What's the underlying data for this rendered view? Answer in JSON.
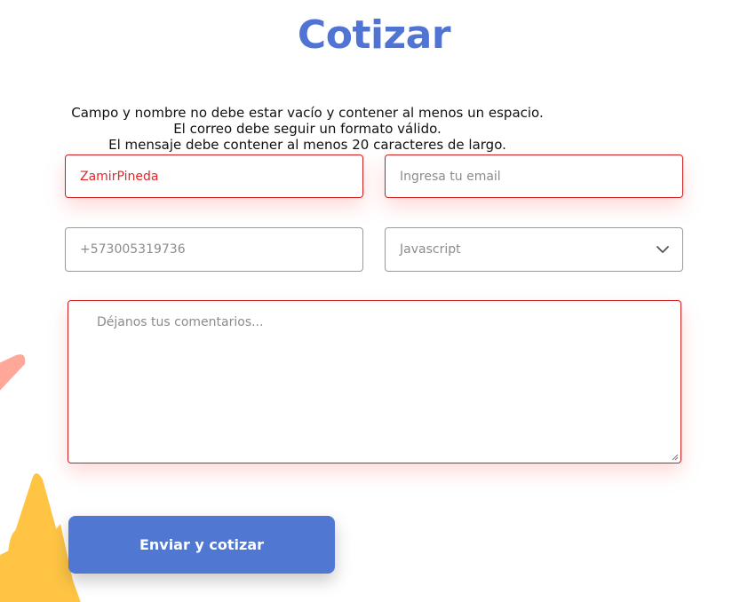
{
  "page": {
    "title": "Cotizar"
  },
  "errors": [
    "Campo y nombre no debe estar vacío y contener al menos un espacio.",
    "El correo debe seguir un formato válido.",
    "El mensaje debe contener al menos 20 caracteres de largo."
  ],
  "form": {
    "name": {
      "value": "ZamirPineda",
      "placeholder": "",
      "state": "invalid"
    },
    "email": {
      "value": "",
      "placeholder": "Ingresa tu email",
      "state": "invalid"
    },
    "phone": {
      "value": "",
      "placeholder": "+573005319736",
      "state": "normal"
    },
    "language": {
      "selected": "Javascript",
      "icon": "chevron-down-icon"
    },
    "comments": {
      "value": "",
      "placeholder": "Déjanos tus comentarios...",
      "state": "invalid"
    },
    "submit_label": "Enviar y cotizar"
  },
  "colors": {
    "accent": "#4f74d4",
    "button": "#5078d2",
    "error": "#d21c1c",
    "decoration_peach": "#ffa89a",
    "decoration_star": "#ffc444"
  }
}
